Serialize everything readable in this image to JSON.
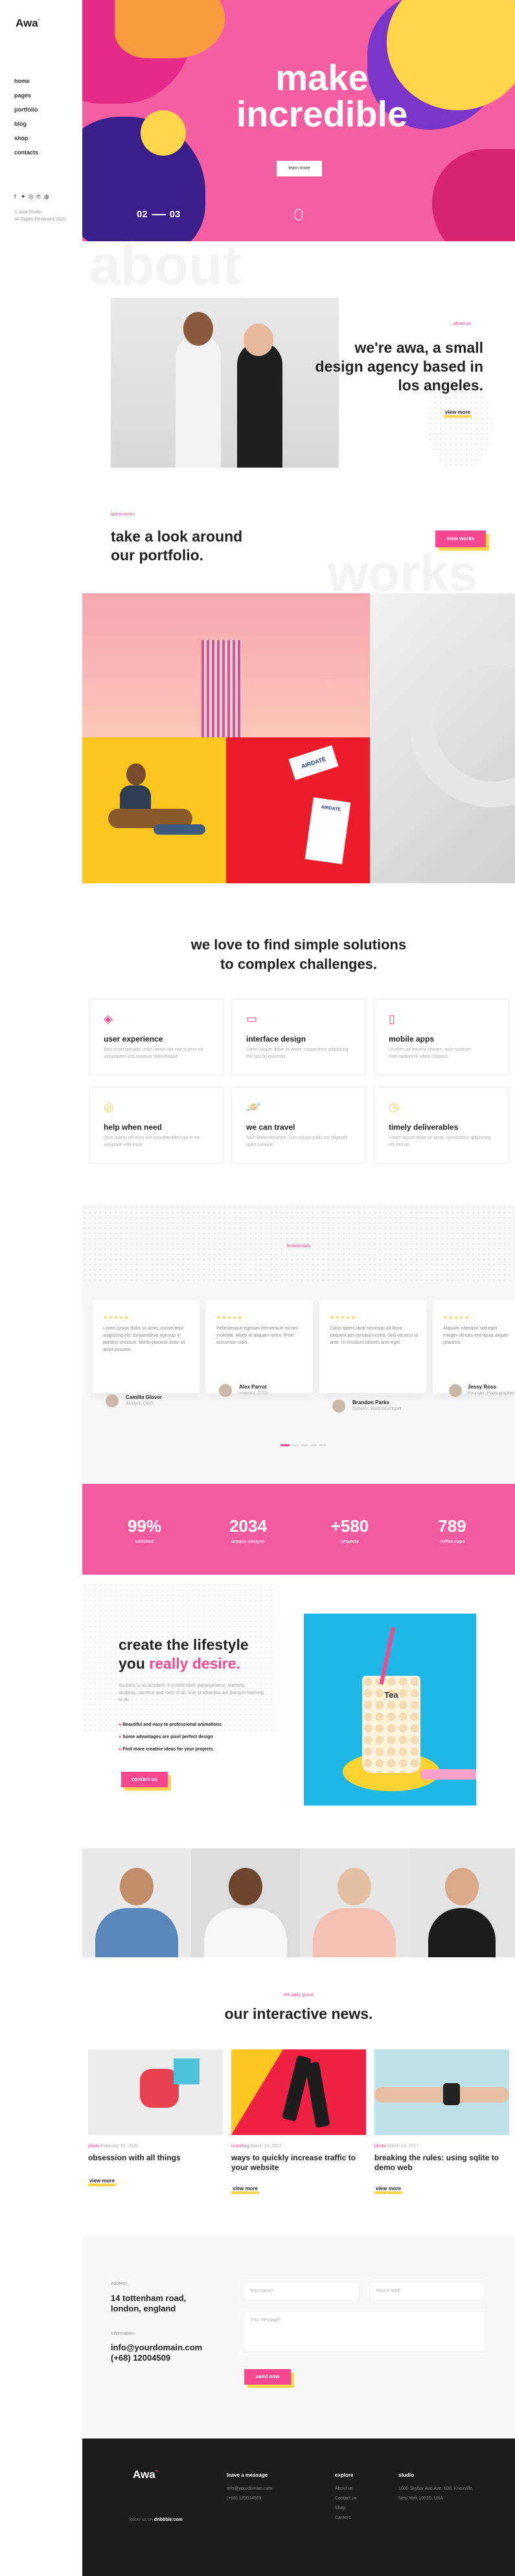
{
  "brand": {
    "logo": "Awa",
    "mark": "°"
  },
  "nav": [
    "home",
    "pages",
    "portfolio",
    "blog",
    "shop",
    "contacts"
  ],
  "social_icons": [
    "facebook-icon",
    "twitter-icon",
    "instagram-icon",
    "pinterest-icon",
    "dribbble-icon"
  ],
  "sidebar": {
    "copyright_1": "© Awa Studio.",
    "copyright_2": "All Rights Reserved 2020"
  },
  "hero": {
    "title_1": "make",
    "title_2": "incredible",
    "button": "learn more",
    "counter_current": "02",
    "counter_total": "03"
  },
  "about": {
    "ghost": "about",
    "label": "about us",
    "heading_1": "we're awa, a small",
    "heading_2": "design agency based in",
    "heading_3": "los angeles.",
    "link": "view more"
  },
  "works": {
    "label": "latest works",
    "heading_1": "take a look around",
    "heading_2": "our portfolio.",
    "button": "view works",
    "ghost": "works",
    "tag_text": "AIRDATE"
  },
  "services": {
    "heading_1": "we love to find simple solutions",
    "heading_2": "to complex challenges.",
    "items": [
      {
        "title": "user experience",
        "desc": "Sed ut perspiciatis unde omnis iste natus error sit voluptatem accusantium doloremque."
      },
      {
        "title": "interface design",
        "desc": "Lorem ipsum dolor sit amet, consectetur adipiscing elit sed do eiusmod."
      },
      {
        "title": "mobile apps",
        "desc": "Ut enim ad minima veniam, quis nostrum exercitationem ullam corporis."
      },
      {
        "title": "help when need",
        "desc": "Quis autem vel eum iure reprehenderit qui in ea voluptate velit esse."
      },
      {
        "title": "we can travel",
        "desc": "Nam libero tempore, cum soluta nobis est eligendi optio cumque."
      },
      {
        "title": "timely deliverables",
        "desc": "Lorem ipsum dolor sit amet, consectetur adipiscing elit sed do."
      }
    ]
  },
  "testimonials": {
    "label": "testimonials",
    "items": [
      {
        "stars": "★★★★★",
        "quote": "Lorem ipsum dolor sit amet, consectetur adipiscing elit. Suspendisse egestas in porttitor tincidunt. Morbi placerat dolor sit amet posuere.",
        "name": "Camilla Glover",
        "role": "Analyst, CEO"
      },
      {
        "stars": "★★★★★",
        "quote": "Pellentesque egestas elementum mi nec molestie. Morbi at aliquam tortor. Proin accumsan odio.",
        "name": "Alex Parrot",
        "role": "Investor, CTO"
      },
      {
        "stars": "★★★★★",
        "quote": "Class aptent taciti sociosqu ad litora torquent per conubia nostra. Sed vel arcu ut ante. Ut tincidunt lobortis ante eget.",
        "name": "Brandon Parks",
        "role": "Director, Web Developer"
      },
      {
        "stars": "★★★★★",
        "quote": "Aliquam interdum sed eget. Integer ultrices sed ligula aliquet pharetra.",
        "name": "Jessy Ross",
        "role": "Founder, Photographer"
      }
    ]
  },
  "stats": [
    {
      "value": "99%",
      "label": "satisfied"
    },
    {
      "value": "2034",
      "label": "unique designs"
    },
    {
      "value": "+580",
      "label": "projects"
    },
    {
      "value": "789",
      "label": "coffee cups"
    }
  ],
  "lifestyle": {
    "heading_1": "create the lifestyle",
    "heading_2a": "you ",
    "heading_2b": "really desire.",
    "desc": "Success is no accident. It is hard work, perseverance, learning, studying, sacrifice and most of all, love of what you are doing or learning to do.",
    "bullets": [
      "Beautiful and easy to professional animations",
      "Some advantages are pixel perfect design",
      "Find more creative ideas for your projects"
    ],
    "button": "contact us",
    "cup_label": "Tea"
  },
  "news": {
    "label": "the daily grand",
    "heading": "our interactive news.",
    "items": [
      {
        "category": "photo",
        "date": "February 10, 2020",
        "title_1": "obsession with all things",
        "title_2": "",
        "link": "view more"
      },
      {
        "category": "branding",
        "date": "March 14, 2017",
        "title_1": "ways to quickly increase traffic to",
        "title_2": "your website",
        "link": "view more"
      },
      {
        "category": "photo",
        "date": "March 14, 2017",
        "title_1": "breaking the rules: using sqlite to",
        "title_2": "demo web",
        "link": "view more"
      }
    ]
  },
  "contact": {
    "address_label": "Address",
    "address_1": "14 tottenham road,",
    "address_2": "london, england",
    "info_label": "Information",
    "email": "info@yourdomain.com",
    "phone": "(+68) 12004509",
    "name_ph": "Your name*",
    "email_ph": "Your e-mail*",
    "message_ph": "Your message*",
    "button": "send now"
  },
  "footer": {
    "logo": "Awa",
    "mark": "°",
    "follow_label": "follow us on",
    "follow_link": "dribbble.com",
    "col1_title": "leave a message",
    "col1_lines": [
      "info@yourdomain.com",
      "(+68) 120034509"
    ],
    "col2_title": "explore",
    "col2_lines": [
      "About us",
      "Contact us",
      "Shop",
      "Careers"
    ],
    "col3_title": "studio",
    "col3_lines": [
      "1000 Skybar Ave Ave, 600, Knoxville,",
      "New York 10010, USA"
    ]
  }
}
